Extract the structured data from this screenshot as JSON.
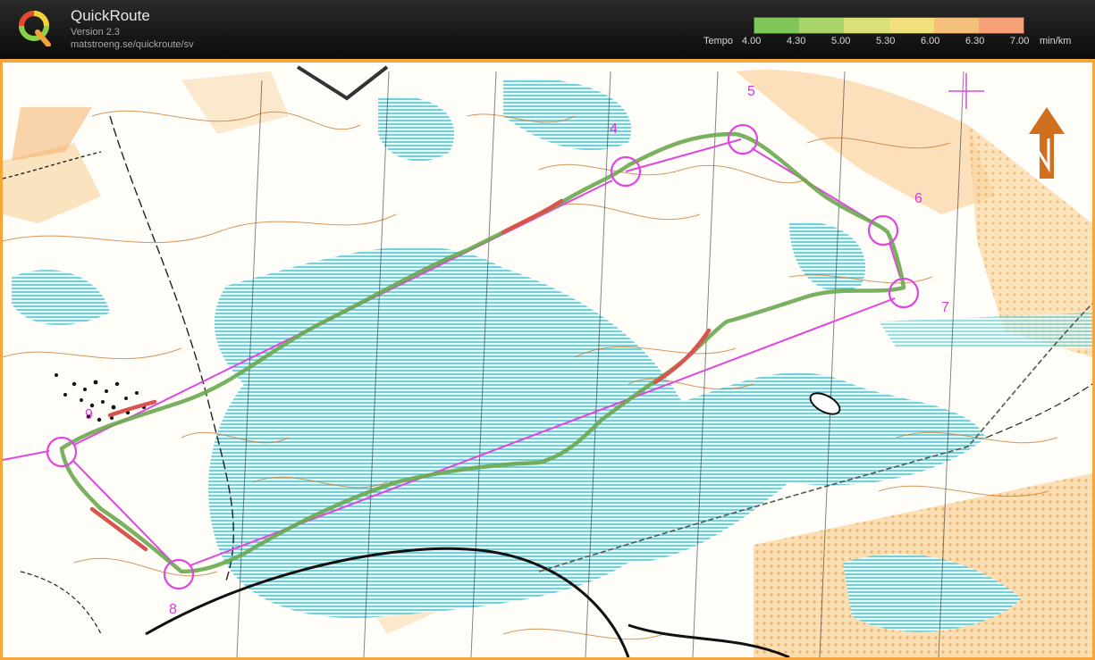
{
  "app": {
    "title": "QuickRoute",
    "version": "Version 2.3",
    "url": "matstroeng.se/quickroute/sv"
  },
  "legend": {
    "label": "Tempo",
    "ticks": [
      "4.00",
      "4.30",
      "5.00",
      "5.30",
      "6.00",
      "6.30",
      "7.00"
    ],
    "unit": "min/km",
    "colors": [
      "#7fc75a",
      "#a9d46a",
      "#d9e07a",
      "#f2e07c",
      "#f5c07a",
      "#f5a077"
    ]
  },
  "controls": [
    {
      "num": "4"
    },
    {
      "num": "5"
    },
    {
      "num": "6"
    },
    {
      "num": "7"
    },
    {
      "num": "8"
    },
    {
      "num": "9"
    }
  ],
  "colors": {
    "course": "#e046e0",
    "route_fast": "#6aa84f",
    "route_slow": "#d9534f",
    "water": "#3fbfc7",
    "terrain": "#f4b06a",
    "contour": "#c8742a"
  }
}
